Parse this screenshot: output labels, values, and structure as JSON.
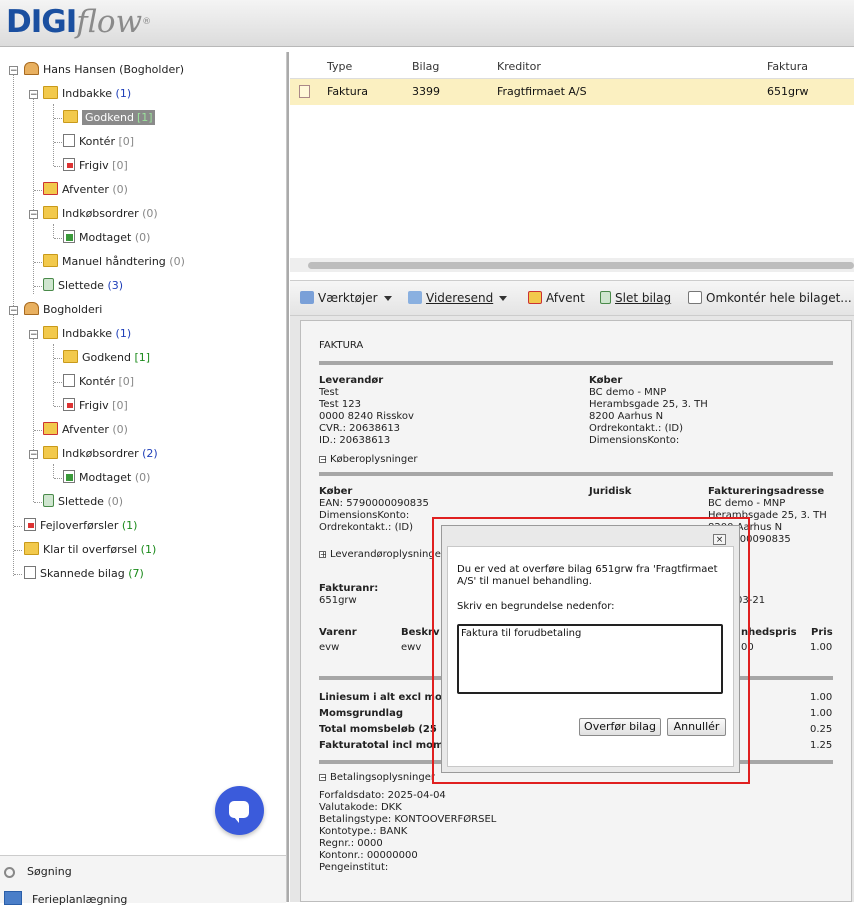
{
  "app": {
    "logo_main": "DIGI",
    "logo_sub": "flow",
    "logo_tm": "®"
  },
  "tree": {
    "items": [
      {
        "label": "Hans Hansen (Bogholder)",
        "count": ""
      },
      {
        "label": "Indbakke",
        "count": "(1)"
      },
      {
        "label": "Godkend",
        "count": "[1]"
      },
      {
        "label": "Kontér",
        "count": "[0]"
      },
      {
        "label": "Frigiv",
        "count": "[0]"
      },
      {
        "label": "Afventer",
        "count": "(0)"
      },
      {
        "label": "Indkøbsordrer",
        "count": "(0)"
      },
      {
        "label": "Modtaget",
        "count": "(0)"
      },
      {
        "label": "Manuel håndtering",
        "count": "(0)"
      },
      {
        "label": "Slettede",
        "count": "(3)"
      },
      {
        "label": "Bogholderi",
        "count": ""
      },
      {
        "label": "Indbakke",
        "count": "(1)"
      },
      {
        "label": "Godkend",
        "count": "[1]"
      },
      {
        "label": "Kontér",
        "count": "[0]"
      },
      {
        "label": "Frigiv",
        "count": "[0]"
      },
      {
        "label": "Afventer",
        "count": "(0)"
      },
      {
        "label": "Indkøbsordrer",
        "count": "(2)"
      },
      {
        "label": "Modtaget",
        "count": "(0)"
      },
      {
        "label": "Slettede",
        "count": "(0)"
      },
      {
        "label": "Fejloverførsler",
        "count": "(1)"
      },
      {
        "label": "Klar til overførsel",
        "count": "(1)"
      },
      {
        "label": "Skannede bilag",
        "count": "(7)"
      }
    ],
    "search_label": "Søgning",
    "calendar_label": "Ferieplanlægning"
  },
  "grid": {
    "columns": [
      "Type",
      "Bilag",
      "Kreditor",
      "Faktura"
    ],
    "row": {
      "type": "Faktura",
      "bilag": "3399",
      "kreditor": "Fragtfirmaet A/S",
      "faktura": "651grw"
    }
  },
  "toolbar": {
    "tools": "Værktøjer",
    "forward": "Videresend",
    "hold": "Afvent",
    "delete": "Slet bilag",
    "recode": "Omkontér hele bilaget..."
  },
  "document": {
    "title": "FAKTURA",
    "supplier": {
      "heading": "Leverandør",
      "lines": [
        "Test",
        "Test 123",
        "0000 8240 Risskov",
        "CVR.: 20638613",
        "ID.: 20638613"
      ]
    },
    "buyer": {
      "heading": "Køber",
      "lines": [
        "BC demo - MNP",
        "Herambsgade 25, 3. TH",
        "8200 Aarhus N",
        "Ordrekontakt.: (ID)",
        "DimensionsKonto:"
      ]
    },
    "buyer_info_toggle": "Køberoplysninger",
    "koeber2": {
      "heading": "Køber",
      "lines": [
        "EAN: 5790000090835",
        "DimensionsKonto:",
        "Ordrekontakt.: (ID)"
      ]
    },
    "juridisk": "Juridisk",
    "billing": {
      "heading": "Faktureringsadresse",
      "lines": [
        "BC demo - MNP",
        "Herambsgade 25, 3. TH",
        "8200 Aarhus N",
        "5790000090835"
      ]
    },
    "supplier_info_toggle": "Leverandøroplysninger",
    "invoice_no_label": "Fakturanr:",
    "invoice_no": "651grw",
    "date_fragment": "03-21",
    "line_headers": {
      "varenr": "Varenr",
      "beskr": "Beskrv",
      "enhedspris": "nhedspris",
      "pris": "Pris"
    },
    "line_row": {
      "varenr": "evw",
      "beskr": "ewv",
      "enhedspris": "00",
      "pris": "1.00"
    },
    "totals": [
      {
        "label": "Liniesum i alt excl mo",
        "value": "1.00"
      },
      {
        "label": "Momsgrundlag",
        "value": "1.00"
      },
      {
        "label": "Total momsbeløb (25",
        "value": "0.25"
      },
      {
        "label": "Fakturatotal incl mom",
        "value": "1.25"
      }
    ],
    "payment_toggle": "Betalingsoplysninger",
    "payment_lines": [
      "Forfaldsdato: 2025-04-04",
      "Valutakode: DKK",
      "Betalingstype: KONTOOVERFØRSEL",
      "Kontotype.: BANK",
      "Regnr.: 0000",
      "Kontonr.: 00000000",
      "Pengeinstitut:"
    ]
  },
  "dialog": {
    "close": "×",
    "message": "Du er ved at overføre bilag 651grw fra 'Fragtfirmaet A/S' til manuel behandling.",
    "prompt": "Skriv en begrundelse nedenfor:",
    "text_value": "Faktura til forudbetaling",
    "confirm": "Overfør bilag",
    "cancel": "Annullér"
  }
}
